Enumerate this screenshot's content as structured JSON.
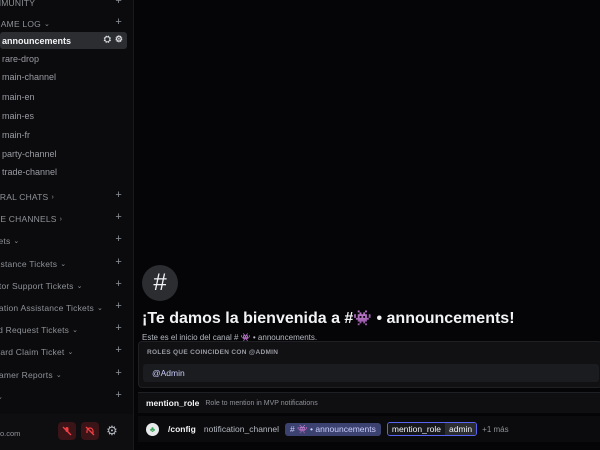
{
  "sidebar": {
    "categories": [
      {
        "label": "MMUNITY",
        "chevron": false
      },
      {
        "label": "GAME LOG",
        "chevron": true
      },
      {
        "label": "ERAL CHATS",
        "chevron": true
      },
      {
        "label": "CE CHANNELS",
        "chevron": true
      },
      {
        "label": "kets",
        "chevron": true
      },
      {
        "label": "sistance Tickets",
        "chevron": true
      },
      {
        "label": "ntor Support Tickets",
        "chevron": true
      },
      {
        "label": "nation Assistance Tickets",
        "chevron": true
      },
      {
        "label": "ild Request Tickets",
        "chevron": true
      },
      {
        "label": "ward Claim Ticket",
        "chevron": true
      },
      {
        "label": "eamer Reports",
        "chevron": true
      },
      {
        "label": "",
        "chevron": true
      }
    ],
    "channels": [
      {
        "label": "announcements",
        "active": true
      },
      {
        "label": "rare-drop",
        "active": false
      },
      {
        "label": "main-channel",
        "active": false
      },
      {
        "label": "main-en",
        "active": false
      },
      {
        "label": "main-es",
        "active": false
      },
      {
        "label": "main-fr",
        "active": false
      },
      {
        "label": "party-channel",
        "active": false
      },
      {
        "label": "trade-channel",
        "active": false
      }
    ],
    "plus": "+",
    "chevron": "⌄",
    "user": {
      "name_fragment": "o.com"
    }
  },
  "main": {
    "hash": "#",
    "welcome_prefix": "¡Te damos la bienvenida a #",
    "welcome_emoji": "👾",
    "welcome_sep": " • ",
    "welcome_channel": "announcements!",
    "subtext": "Este es el inicio del canal # 👾 • announcements."
  },
  "popup": {
    "title": "ROLES QUE COINCIDEN CON @ADMIN",
    "item": "@Admin"
  },
  "option_hint": {
    "name": "mention_role",
    "description": "Role to mention in MVP notifications"
  },
  "command": {
    "name": "/config",
    "param1": "notification_channel",
    "channel_pill": "# 👾 • announcements",
    "param2_key": "mention_role",
    "param2_value": "admin",
    "more": "+1 más"
  },
  "colors": {
    "accent": "#5865f2",
    "danger": "#f23f43",
    "mention": "#c9cdfb"
  }
}
